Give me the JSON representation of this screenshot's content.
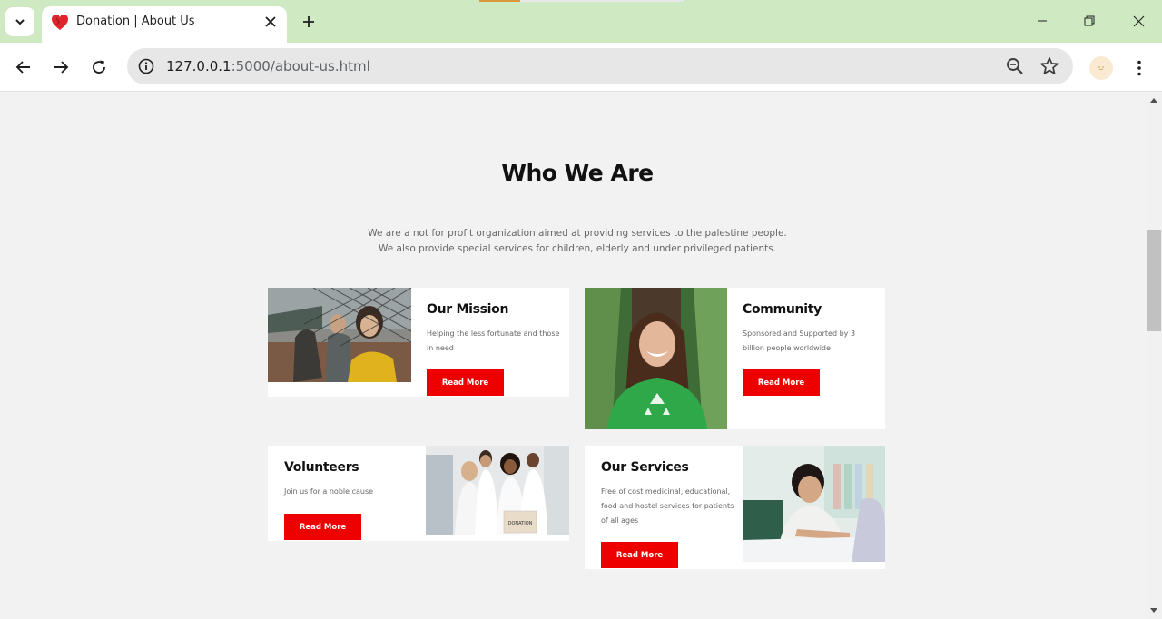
{
  "browser": {
    "tab_title": "Donation | About Us",
    "url_host": "127.0.0.1",
    "url_rest": ":5000/about-us.html"
  },
  "section": {
    "heading": "Who We Are",
    "intro_line1": "We are a not for profit organization aimed at providing services to the palestine people.",
    "intro_line2": "We also provide special services for children, elderly and under privileged patients."
  },
  "cards": [
    {
      "title": "Our Mission",
      "text": "Helping the less fortunate and those in need",
      "button": "Read More",
      "image": "children-at-fence-photo"
    },
    {
      "title": "Community",
      "text": "Sponsored and Supported by 3 billion people worldwide",
      "button": "Read More",
      "image": "smiling-girl-green-shirt-photo"
    },
    {
      "title": "Volunteers",
      "text": "Join us for a noble cause",
      "button": "Read More",
      "image": "volunteers-group-photo"
    },
    {
      "title": "Our Services",
      "text": "Free of cost medicinal, educational, food and hostel services for patients of all ages",
      "button": "Read More",
      "image": "girl-studying-photo"
    }
  ],
  "colors": {
    "accent_red": "#ee0000",
    "titlebar": "#cfe9c2",
    "page_bg": "#f2f2f2"
  }
}
